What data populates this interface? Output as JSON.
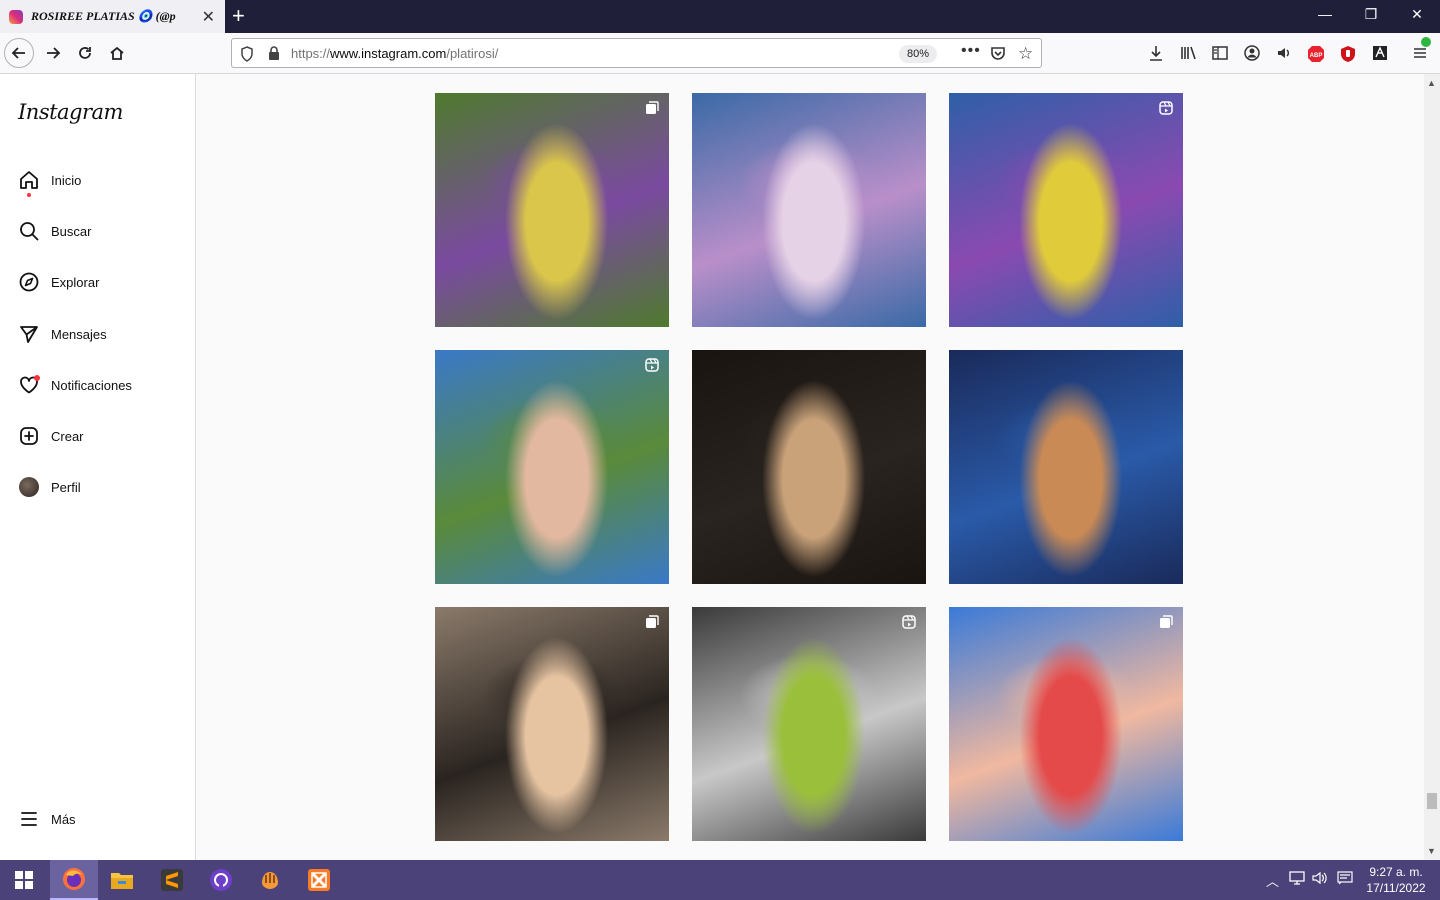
{
  "browser": {
    "tab_title": "ROSIREE PLATIAS 🧿 (@p",
    "url_host": "www.instagram.com",
    "url_scheme": "https://",
    "url_path": "/platirosi/",
    "zoom": "80%"
  },
  "sidebar": {
    "logo": "Instagram",
    "items": [
      {
        "label": "Inicio",
        "icon": "home-icon"
      },
      {
        "label": "Buscar",
        "icon": "search-icon"
      },
      {
        "label": "Explorar",
        "icon": "compass-icon"
      },
      {
        "label": "Mensajes",
        "icon": "send-icon"
      },
      {
        "label": "Notificaciones",
        "icon": "heart-icon"
      },
      {
        "label": "Crear",
        "icon": "plus-square-icon"
      },
      {
        "label": "Perfil",
        "icon": "avatar"
      }
    ],
    "more_label": "Más"
  },
  "posts": [
    {
      "badge": "carousel-icon",
      "palette": [
        "#4f7a2e",
        "#d9c64a",
        "#7a4aa0"
      ]
    },
    {
      "badge": "",
      "palette": [
        "#3a6aa6",
        "#e6d2e6",
        "#b98fc9"
      ]
    },
    {
      "badge": "reel-icon",
      "palette": [
        "#2f5fa8",
        "#e0cc3a",
        "#8a4ab0"
      ]
    },
    {
      "badge": "reel-icon",
      "palette": [
        "#3a79c8",
        "#e2b8a0",
        "#5a8a3a"
      ]
    },
    {
      "badge": "",
      "palette": [
        "#1a1410",
        "#c9a27a",
        "#2a2420"
      ]
    },
    {
      "badge": "",
      "palette": [
        "#1a2a5a",
        "#c98a55",
        "#2a5aa8"
      ]
    },
    {
      "badge": "carousel-icon",
      "palette": [
        "#8a7a6a",
        "#e6c4a2",
        "#2a2420"
      ]
    },
    {
      "badge": "reel-icon",
      "palette": [
        "#3a3a3a",
        "#9abf3a",
        "#c8c8c8"
      ]
    },
    {
      "badge": "carousel-icon",
      "palette": [
        "#3a7ad8",
        "#e44a4a",
        "#f0b8a0"
      ]
    }
  ],
  "taskbar": {
    "time": "9:27 a. m.",
    "date": "17/11/2022",
    "apps": [
      "firefox-icon",
      "file-explorer-icon",
      "sublime-icon",
      "github-icon",
      "fiddler-icon",
      "xampp-icon"
    ]
  },
  "colors": {
    "tab_bar": "#1f1f3a",
    "taskbar": "#4a4278",
    "notification": "#ff3040"
  }
}
